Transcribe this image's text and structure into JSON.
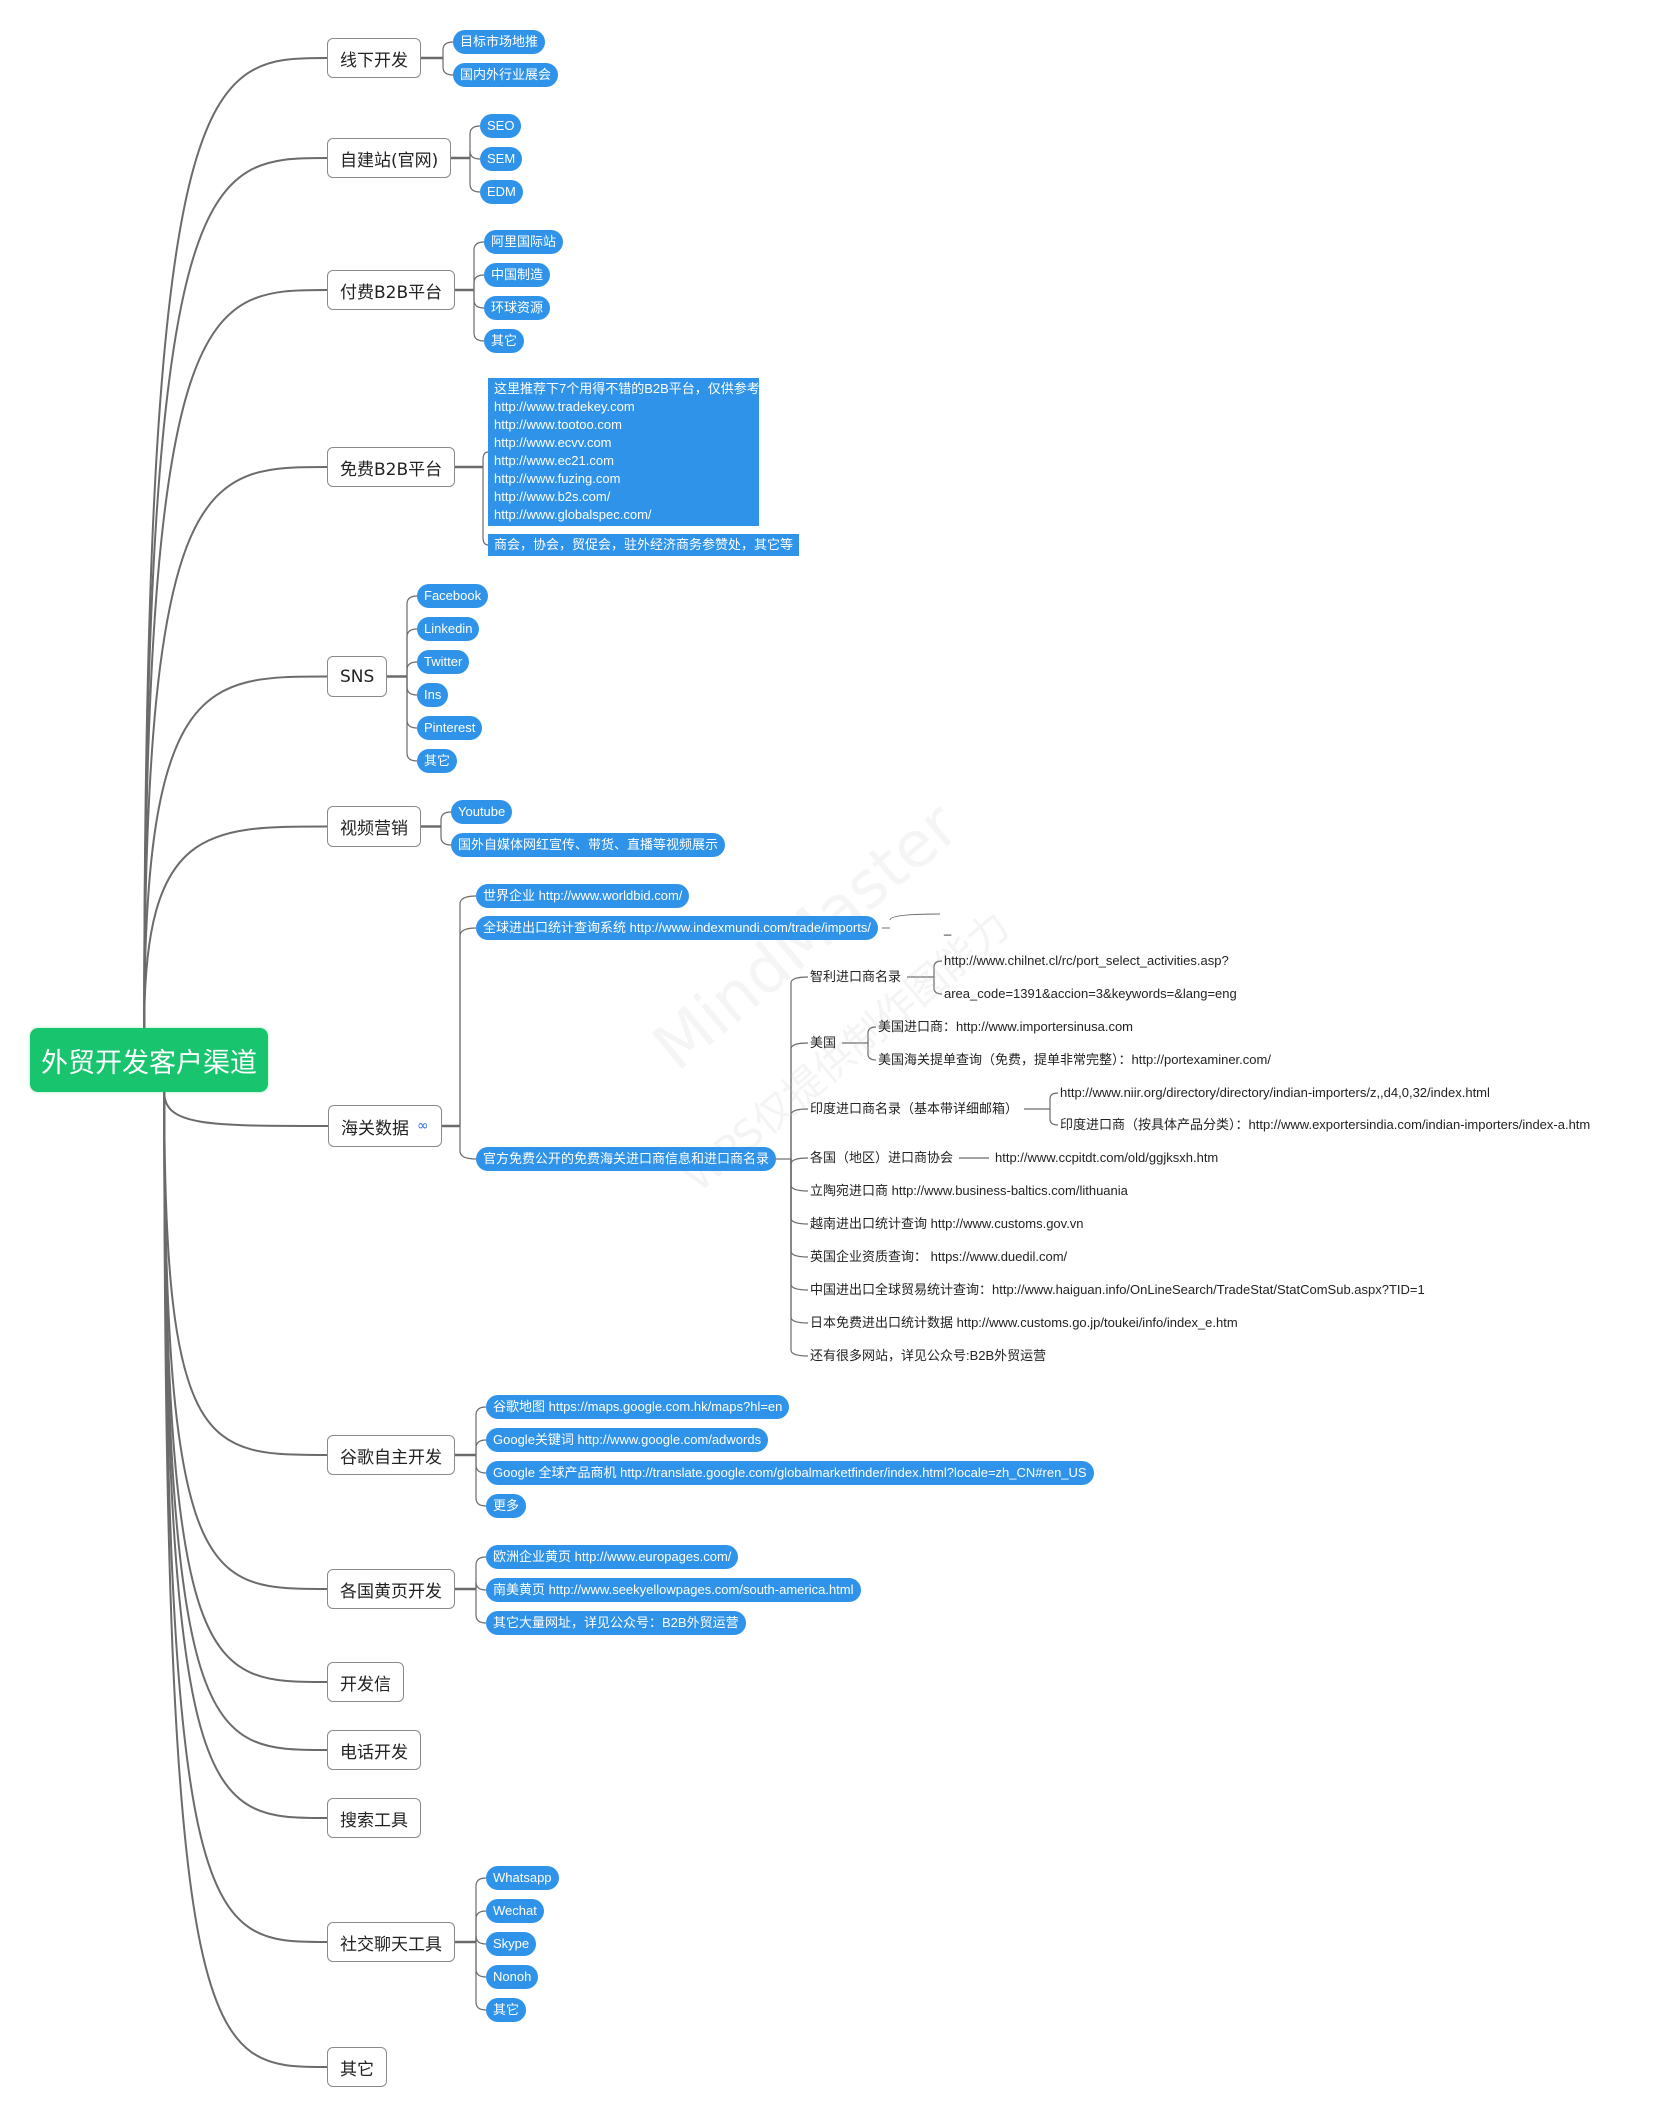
{
  "root": {
    "label": "外贸开发客户渠道",
    "color": "#19c46e"
  },
  "accent_color": "#2f93ea",
  "watermark": {
    "line1": "MindMaster",
    "line2": "WPS仅提供制作图能力"
  },
  "branches": {
    "offline": {
      "label": "线下开发",
      "children": [
        "目标市场地推",
        "国内外行业展会"
      ]
    },
    "website": {
      "label": "自建站(官网)",
      "children": [
        "SEO",
        "SEM",
        "EDM"
      ]
    },
    "paid_b2b": {
      "label": "付费B2B平台",
      "children": [
        "阿里国际站",
        "中国制造",
        "环球资源",
        "其它"
      ]
    },
    "free_b2b": {
      "label": "免费B2B平台",
      "block": "这里推荐下7个用得不错的B2B平台，仅供参考：\nhttp://www.tradekey.com\nhttp://www.tootoo.com\nhttp://www.ecvv.com\nhttp://www.ec21.com\nhttp://www.fuzing.com\nhttp://www.b2s.com/\nhttp://www.globalspec.com/",
      "extra": "商会，协会，贸促会，驻外经济商务参赞处，其它等"
    },
    "sns": {
      "label": "SNS",
      "children": [
        "Facebook",
        "Linkedin",
        "Twitter",
        "Ins",
        "Pinterest",
        "其它"
      ]
    },
    "video": {
      "label": "视频营销",
      "children": [
        "Youtube",
        "国外自媒体网红宣传、带货、直播等视频展示"
      ]
    },
    "customs": {
      "label": "海关数据",
      "icon": "link-icon",
      "children": [
        "世界企业 http://www.worldbid.com/",
        "全球进出口统计查询系统 http://www.indexmundi.com/trade/imports/",
        "官方免费公开的免费海关进口商信息和进口商名录"
      ],
      "indexmundi_child": "_",
      "directory": {
        "chile": {
          "label": "智利进口商名录",
          "items": [
            "http://www.chilnet.cl/rc/port_select_activities.asp?",
            "area_code=1391&accion=3&keywords=&lang=eng"
          ]
        },
        "usa": {
          "label": "美国",
          "items": [
            "美国进口商：http://www.importersinusa.com",
            "美国海关提单查询（免费，提单非常完整）：http://portexaminer.com/"
          ]
        },
        "india": {
          "label": "印度进口商名录（基本带详细邮箱）",
          "items": [
            "http://www.niir.org/directory/directory/indian-importers/z,,d4,0,32/index.html",
            "印度进口商（按具体产品分类）：http://www.exportersindia.com/indian-importers/index-a.htm"
          ]
        },
        "assoc": {
          "label": "各国（地区）进口商协会",
          "item": "http://www.ccpitdt.com/old/ggjksxh.htm"
        },
        "others": [
          "立陶宛进口商  http://www.business-baltics.com/lithuania",
          "越南进出口统计查询  http://www.customs.gov.vn",
          "英国企业资质查询：  https://www.duedil.com/",
          "中国进出口全球贸易统计查询：http://www.haiguan.info/OnLineSearch/TradeStat/StatComSub.aspx?TID=1",
          "日本免费进出口统计数据 http://www.customs.go.jp/toukei/info/index_e.htm",
          "还有很多网站，详见公众号:B2B外贸运营"
        ]
      }
    },
    "google": {
      "label": "谷歌自主开发",
      "children": [
        "谷歌地图 https://maps.google.com.hk/maps?hl=en",
        "Google关键词 http://www.google.com/adwords",
        "Google 全球产品商机 http://translate.google.com/globalmarketfinder/index.html?locale=zh_CN#ren_US",
        "更多"
      ]
    },
    "yellow": {
      "label": "各国黄页开发",
      "children": [
        "欧洲企业黄页 http://www.europages.com/",
        "南美黄页 http://www.seekyellowpages.com/south-america.html",
        "其它大量网址，详见公众号：B2B外贸运营"
      ]
    },
    "letter": {
      "label": "开发信"
    },
    "phone": {
      "label": "电话开发"
    },
    "search": {
      "label": "搜索工具"
    },
    "chat": {
      "label": "社交聊天工具",
      "children": [
        "Whatsapp",
        "Wechat",
        "Skype",
        "Nonoh",
        "其它"
      ]
    },
    "other": {
      "label": "其它"
    }
  }
}
